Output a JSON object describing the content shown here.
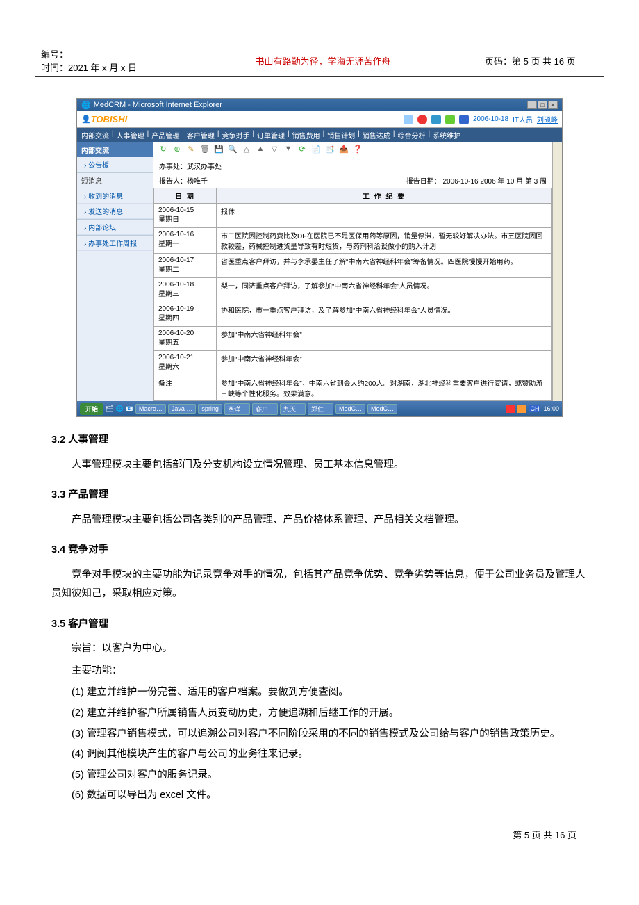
{
  "header": {
    "left_line1": "编号：",
    "left_line2": "时间：2021 年 x 月 x 日",
    "motto": "书山有路勤为径，学海无涯苦作舟",
    "right": "页码：第 5 页 共 16 页"
  },
  "screenshot": {
    "window_title": "MedCRM - Microsoft Internet Explorer",
    "brand": "TOBISHI",
    "brand_right_date": "2006-10-18",
    "brand_right_role": "IT人员",
    "brand_right_user": "刘硕峰",
    "menubar": [
      "内部交流",
      "人事管理",
      "产品管理",
      "客户管理",
      "竞争对手",
      "订单管理",
      "销售费用",
      "销售计划",
      "销售达成",
      "综合分析",
      "系统维护"
    ],
    "sidebar": {
      "header": "内部交流",
      "items": [
        "› 公告板",
        "短消息",
        "› 收到的消息",
        "› 发送的消息",
        "› 内部论坛",
        "› 办事处工作周报"
      ]
    },
    "toolbar_icons": [
      "↻",
      "⊕",
      "✎",
      "🗑",
      "💾",
      "🔍",
      "△",
      "▲",
      "▽",
      "▼",
      "⟳",
      "📄",
      "📑",
      "📤",
      "❓"
    ],
    "meta": {
      "office_label": "办事处：",
      "office_value": "武汉办事处",
      "reporter_label": "报告人：",
      "reporter_value": "杨唯千",
      "date_label": "报告日期：",
      "date_value": "2006-10-16  2006 年 10 月 第 3 周"
    },
    "table": {
      "col_date": "日 期",
      "col_summary": "工 作 纪 要",
      "rows": [
        {
          "date": "2006-10-15",
          "weekday": "星期日",
          "summary": "报休"
        },
        {
          "date": "2006-10-16",
          "weekday": "星期一",
          "summary": "市二医院因控制药费比及DF在医院已不是医保用药等原因，销量停滞，暂无较好解决办法。市五医院因回款较差，药械控制进货量导致有时短货，与药剂科洽谈做小的购入计划"
        },
        {
          "date": "2006-10-17",
          "weekday": "星期二",
          "summary": "省医重点客户拜访，并与李承晏主任了解“中南六省神经科年会”筹备情况。四医院慢慢开始用药。"
        },
        {
          "date": "2006-10-18",
          "weekday": "星期三",
          "summary": "梨一，同济重点客户拜访，了解参加“中南六省神经科年会”人员情况。"
        },
        {
          "date": "2006-10-19",
          "weekday": "星期四",
          "summary": "协和医院，市一重点客户拜访，及了解参加“中南六省神经科年会”人员情况。"
        },
        {
          "date": "2006-10-20",
          "weekday": "星期五",
          "summary": "参加“中南六省神经科年会”"
        },
        {
          "date": "2006-10-21",
          "weekday": "星期六",
          "summary": "参加“中南六省神经科年会”"
        }
      ],
      "remark_label": "备注",
      "remark_value": "参加“中南六省神经科年会”，中南六省到会大约200人。对湖南，湖北神经科重要客户进行宴请，或赞助游三峡等个性化服务。效果满意。"
    },
    "taskbar": {
      "start": "开始",
      "buttons": [
        "Macro…",
        "Java …",
        "spring",
        "西详…",
        "客户…",
        "九天…",
        "郑仁…",
        "MedC…",
        "MedC…"
      ],
      "clock": "16:00"
    }
  },
  "sections": {
    "s32_title": "3.2  人事管理",
    "s32_body": "人事管理模块主要包括部门及分支机构设立情况管理、员工基本信息管理。",
    "s33_title": "3.3  产品管理",
    "s33_body": "产品管理模块主要包括公司各类别的产品管理、产品价格体系管理、产品相关文档管理。",
    "s34_title": "3.4  竞争对手",
    "s34_body": "竞争对手模块的主要功能为记录竞争对手的情况，包括其产品竞争优势、竞争劣势等信息，便于公司业务员及管理人员知彼知己，采取相应对策。",
    "s35_title": "3.5  客户管理",
    "s35_line1": "宗旨：以客户为中心。",
    "s35_line2": "主要功能：",
    "s35_items": [
      "(1) 建立并维护一份完善、适用的客户档案。要做到方便查阅。",
      "(2) 建立并维护客户所属销售人员变动历史，方便追溯和后继工作的开展。",
      "(3) 管理客户销售模式，可以追溯公司对客户不同阶段采用的不同的销售模式及公司给与客户的销售政策历史。",
      "(4) 调阅其他模块产生的客户与公司的业务往来记录。",
      "(5) 管理公司对客户的服务记录。",
      "(6) 数据可以导出为 excel 文件。"
    ]
  },
  "footer": "第  5  页  共  16  页"
}
